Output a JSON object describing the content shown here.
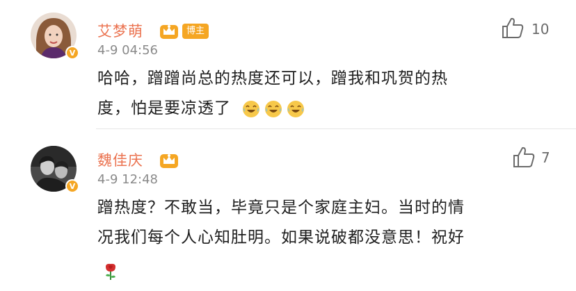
{
  "comments": [
    {
      "username": "艾梦萌",
      "host_tag": "博主",
      "time": "4-9 04:56",
      "likes": "10",
      "text_lines": [
        "哈哈，蹭蹭尚总的热度还可以，蹭我和巩贺的热",
        "度，怕是要凉透了"
      ],
      "emoji": [
        "laugh-cry-icon",
        "laugh-cry-icon",
        "laugh-cry-icon"
      ]
    },
    {
      "username": "魏佳庆",
      "time": "4-9 12:48",
      "likes": "7",
      "text_lines": [
        "蹭热度？不敢当，毕竟只是个家庭主妇。当时的情",
        "况我们每个人心知肚明。如果说破都没意思！祝好"
      ],
      "emoji": [
        "rose-icon"
      ]
    }
  ],
  "colors": {
    "username": "#eb7350",
    "badge": "#f5a623",
    "time": "#8a8a8a"
  }
}
